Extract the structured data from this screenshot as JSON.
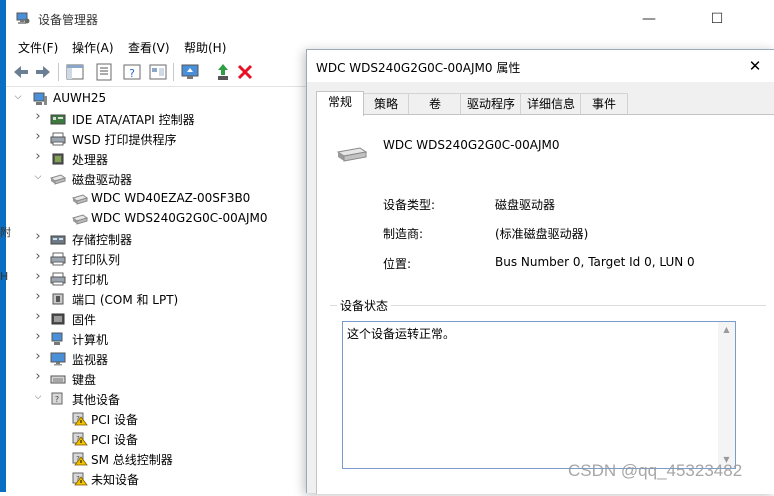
{
  "window": {
    "title": "设备管理器",
    "controls": {
      "minimize": "—",
      "maximize": "☐",
      "close": "✕"
    }
  },
  "menu": [
    "文件(F)",
    "操作(A)",
    "查看(V)",
    "帮助(H)"
  ],
  "toolbar_icons": [
    "back-icon",
    "forward-icon",
    "console-tree-icon",
    "properties-icon",
    "help-icon",
    "details-icon",
    "scan-icon",
    "update-driver-icon",
    "uninstall-icon"
  ],
  "left_edge_fragments": [
    "附",
    "H"
  ],
  "tree": {
    "root": "AUWH25",
    "items": [
      {
        "label": "IDE ATA/ATAPI 控制器",
        "icon": "ide-controller-icon",
        "expanded": false,
        "level": 1
      },
      {
        "label": "WSD 打印提供程序",
        "icon": "printer-icon",
        "expanded": false,
        "level": 1
      },
      {
        "label": "处理器",
        "icon": "processor-icon",
        "expanded": false,
        "level": 1
      },
      {
        "label": "磁盘驱动器",
        "icon": "disk-drive-icon",
        "expanded": true,
        "level": 1
      },
      {
        "label": "WDC WD40EZAZ-00SF3B0",
        "icon": "disk-drive-icon",
        "level": 2
      },
      {
        "label": "WDC WDS240G2G0C-00AJM0",
        "icon": "disk-drive-icon",
        "level": 2
      },
      {
        "label": "存储控制器",
        "icon": "storage-controller-icon",
        "expanded": false,
        "level": 1
      },
      {
        "label": "打印队列",
        "icon": "printer-icon",
        "expanded": false,
        "level": 1
      },
      {
        "label": "打印机",
        "icon": "printer-icon",
        "expanded": false,
        "level": 1
      },
      {
        "label": "端口 (COM 和 LPT)",
        "icon": "port-icon",
        "expanded": false,
        "level": 1
      },
      {
        "label": "固件",
        "icon": "firmware-icon",
        "expanded": false,
        "level": 1
      },
      {
        "label": "计算机",
        "icon": "computer-icon",
        "expanded": false,
        "level": 1
      },
      {
        "label": "监视器",
        "icon": "monitor-icon",
        "expanded": false,
        "level": 1
      },
      {
        "label": "键盘",
        "icon": "keyboard-icon",
        "expanded": false,
        "level": 1
      },
      {
        "label": "其他设备",
        "icon": "unknown-device-icon",
        "expanded": true,
        "level": 1
      },
      {
        "label": "PCI 设备",
        "icon": "warning-device-icon",
        "level": 2
      },
      {
        "label": "PCI 设备",
        "icon": "warning-device-icon",
        "level": 2
      },
      {
        "label": "SM 总线控制器",
        "icon": "warning-device-icon",
        "level": 2
      },
      {
        "label": "未知设备",
        "icon": "warning-device-icon",
        "level": 2
      }
    ]
  },
  "dialog": {
    "title": "WDC WDS240G2G0C-00AJM0 属性",
    "close": "✕",
    "tabs": [
      "常规",
      "策略",
      "卷",
      "驱动程序",
      "详细信息",
      "事件"
    ],
    "active_tab": "常规",
    "device_name": "WDC WDS240G2G0C-00AJM0",
    "properties": [
      {
        "label": "设备类型:",
        "value": "磁盘驱动器"
      },
      {
        "label": "制造商:",
        "value": "(标准磁盘驱动器)"
      },
      {
        "label": "位置:",
        "value": "Bus Number 0, Target Id 0, LUN 0"
      }
    ],
    "status_group_title": "设备状态",
    "status_text": "这个设备运转正常。"
  },
  "watermark": "CSDN @qq_45323482",
  "colors": {
    "accent": "#0a6fc2",
    "warning": "#f2c200",
    "delete_red": "#e81123",
    "focus_border": "#7a9ccc"
  }
}
